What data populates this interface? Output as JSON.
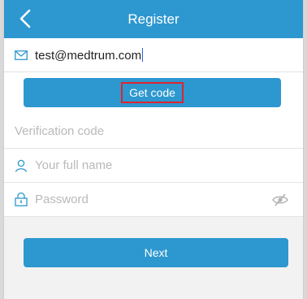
{
  "header": {
    "title": "Register",
    "back_icon": "chevron-left-icon"
  },
  "form": {
    "email_value": "test@medtrum.com",
    "email_icon": "mail-icon",
    "get_code_label": "Get code",
    "verification_placeholder": "Verification code",
    "name_placeholder": "Your full name",
    "name_icon": "user-icon",
    "password_placeholder": "Password",
    "password_icon": "lock-icon",
    "visibility_icon": "eye-off-icon",
    "next_label": "Next"
  },
  "colors": {
    "accent": "#2d97cf",
    "highlight": "#e0232d",
    "background": "#f2f2f2"
  }
}
